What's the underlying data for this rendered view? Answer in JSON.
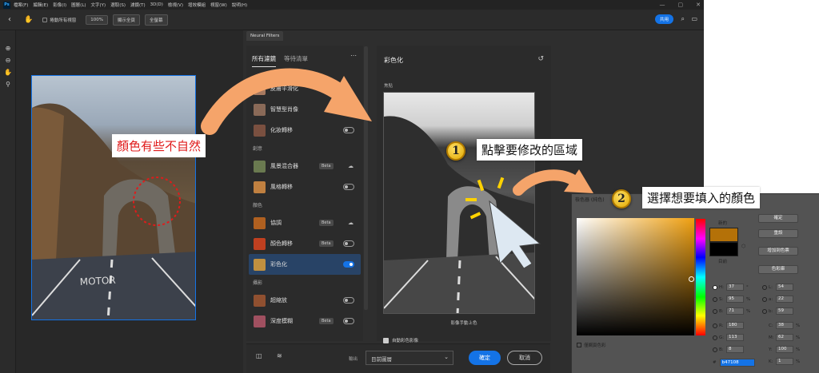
{
  "app": {
    "logo": "Ps",
    "menus": [
      "檔案(F)",
      "編輯(E)",
      "影像(I)",
      "圖層(L)",
      "文字(Y)",
      "選取(S)",
      "濾鏡(T)",
      "3D(D)",
      "檢視(V)",
      "增效模組",
      "視窗(W)",
      "說明(H)"
    ],
    "window_controls": [
      "—",
      "▢",
      "✕"
    ]
  },
  "options_bar": {
    "scroll_all_windows": "捲動所有視窗",
    "zoom": "100%",
    "fit_screen": "顯示全頁",
    "fill_screen": "全螢幕",
    "share": "共用"
  },
  "panel": {
    "tab": "Neural Filters",
    "tabs": [
      "所有濾鏡",
      "等待清單"
    ],
    "sections": {
      "creative": "創意",
      "color": "顏色",
      "photo": "攝影"
    },
    "filters": [
      {
        "label": "皮膚平滑化",
        "thumb_color": "#a87a60"
      },
      {
        "label": "智慧型肖像",
        "thumb_color": "#8a6a58"
      },
      {
        "label": "化妝轉移",
        "thumb_color": "#7a5040"
      },
      {
        "label": "風景混合器",
        "badge": "Beta",
        "thumb_color": "#6a7a50"
      },
      {
        "label": "風格轉移",
        "thumb_color": "#c08040"
      },
      {
        "label": "協調",
        "badge": "Beta",
        "thumb_color": "#b06020"
      },
      {
        "label": "顏色轉移",
        "badge": "Beta",
        "thumb_color": "#c04020"
      },
      {
        "label": "彩色化",
        "thumb_color": "#c09040"
      },
      {
        "label": "超縮放",
        "thumb_color": "#905030"
      },
      {
        "label": "深度模糊",
        "badge": "Beta",
        "thumb_color": "#a05060"
      }
    ],
    "settings": {
      "title": "彩色化",
      "focus": "焦點",
      "caption": "影像手動上色",
      "auto_color": "自動彩色影像"
    },
    "footer": {
      "output_label": "輸出",
      "output_value": "目前圖層",
      "ok": "確定",
      "cancel": "取消"
    }
  },
  "picker": {
    "title": "檢色器 (純色)",
    "new_label": "新的",
    "current_label": "目前",
    "new_color": "#b47108",
    "buttons": [
      "確定",
      "重設",
      "增加到色票",
      "色彩庫"
    ],
    "hsb": [
      {
        "k": "H:",
        "v": "37",
        "u": "°"
      },
      {
        "k": "S:",
        "v": "95",
        "u": "%"
      },
      {
        "k": "B:",
        "v": "71",
        "u": "%"
      }
    ],
    "rgb": [
      {
        "k": "R:",
        "v": "180"
      },
      {
        "k": "G:",
        "v": "113"
      },
      {
        "k": "B:",
        "v": "8"
      }
    ],
    "lab": [
      {
        "k": "L:",
        "v": "54"
      },
      {
        "k": "a:",
        "v": "22"
      },
      {
        "k": "b:",
        "v": "59"
      }
    ],
    "cmyk": [
      {
        "k": "C:",
        "v": "38",
        "u": "%"
      },
      {
        "k": "M:",
        "v": "62",
        "u": "%"
      },
      {
        "k": "Y:",
        "v": "100",
        "u": "%"
      },
      {
        "k": "K:",
        "v": "1",
        "u": "%"
      }
    ],
    "web_only": "僅網頁色彩",
    "hex_label": "#",
    "hex": "b47108"
  },
  "annotations": {
    "note": "顏色有些不自然",
    "step1_num": "1",
    "step1": "點擊要修改的區域",
    "step2_num": "2",
    "step2": "選擇想要填入的顏色",
    "road_text": "MOTOR"
  }
}
